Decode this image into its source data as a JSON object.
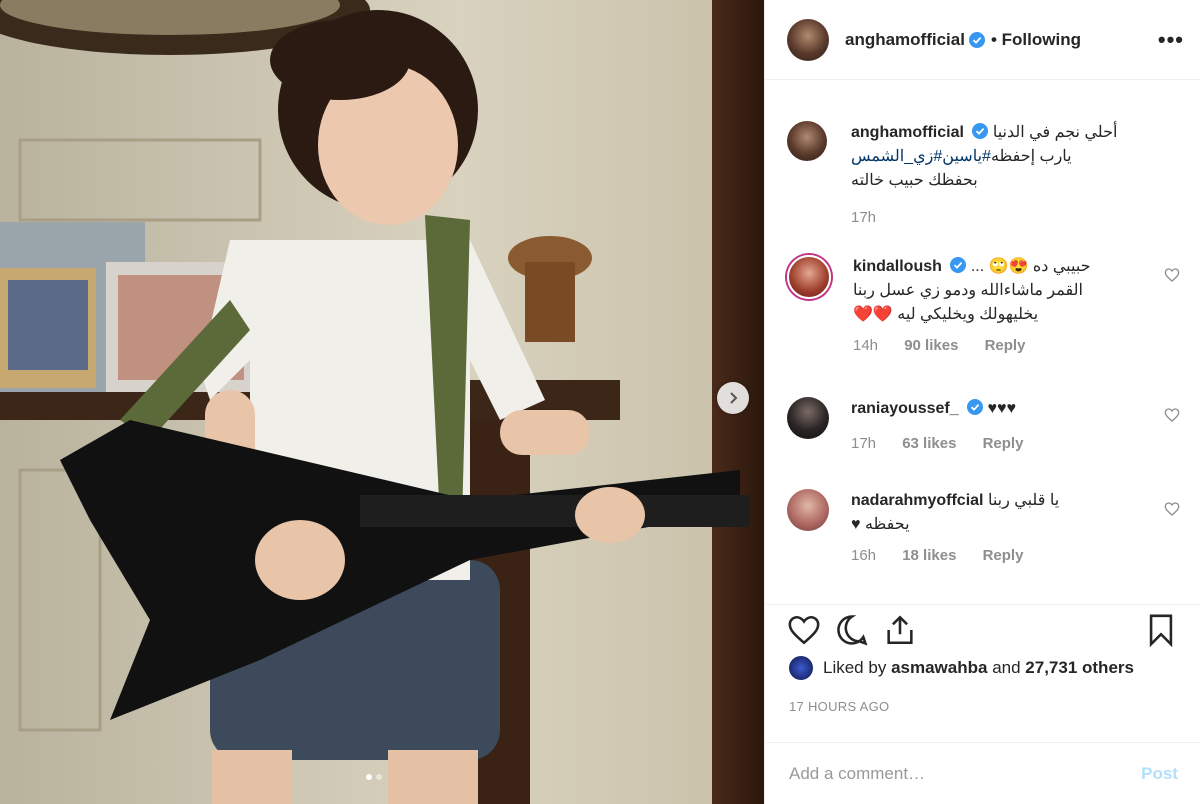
{
  "post": {
    "author": "anghamofficial",
    "follow_status": "• Following",
    "more_label": "•••"
  },
  "caption": {
    "user": "anghamofficial",
    "line1": "أحلي نجم في الدنيا",
    "hashtags": "#ياسين#زي_الشمس",
    "line2_rest": " يارب إحفظه",
    "line3": "بحفظك حبيب خالته",
    "time": "17h"
  },
  "comments": [
    {
      "user": "kindalloush",
      "line1": "حبيبي ده 😍🙄 .‏.‏.",
      "line2": "القمر ماشاءالله ودمو زي عسل ربنا",
      "line3": "يخليهولك ويخليكي ليه ❤️❤️",
      "time": "14h",
      "likes": "90 likes",
      "reply": "Reply"
    },
    {
      "user": "raniayoussef_",
      "line1": "♥♥♥",
      "time": "17h",
      "likes": "63 likes",
      "reply": "Reply"
    },
    {
      "user": "nadarahmyoffcial",
      "line1": "يا قلبي ربنا",
      "line2": "يحفظه ♥",
      "time": "16h",
      "likes": "18 likes",
      "reply": "Reply"
    }
  ],
  "likes": {
    "prefix": "Liked by ",
    "user": "asmawahba",
    "middle": " and ",
    "count": "27,731 others"
  },
  "timestamp": "17 HOURS AGO",
  "comment_box": {
    "placeholder": "Add a comment…",
    "post_label": "Post"
  },
  "carousel": {
    "count": 2,
    "active": 1
  },
  "colors": {
    "verified": "#3897f0",
    "hashtag": "#003569",
    "post_disabled": "#b2dffc"
  }
}
